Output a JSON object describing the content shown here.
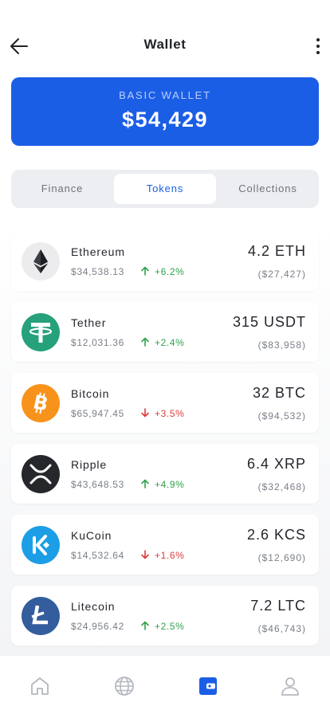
{
  "header": {
    "title": "Wallet"
  },
  "wallet_card": {
    "label": "BASIC WALLET",
    "amount": "$54,429"
  },
  "tabs": [
    {
      "label": "Finance"
    },
    {
      "label": "Tokens"
    },
    {
      "label": "Collections"
    }
  ],
  "tokens": [
    {
      "name": "Ethereum",
      "price": "$34,538.13",
      "change": "+6.2%",
      "direction": "up",
      "amount": "4.2 ETH",
      "value": "($27,427)",
      "icon": "ethereum-icon"
    },
    {
      "name": "Tether",
      "price": "$12,031.36",
      "change": "+2.4%",
      "direction": "up",
      "amount": "315 USDT",
      "value": "($83,958)",
      "icon": "tether-icon"
    },
    {
      "name": "Bitcoin",
      "price": "$65,947.45",
      "change": "+3.5%",
      "direction": "down",
      "amount": "32 BTC",
      "value": "($94,532)",
      "icon": "bitcoin-icon"
    },
    {
      "name": "Ripple",
      "price": "$43,648.53",
      "change": "+4.9%",
      "direction": "up",
      "amount": "6.4 XRP",
      "value": "($32,468)",
      "icon": "ripple-icon"
    },
    {
      "name": "KuCoin",
      "price": "$14,532.64",
      "change": "+1.6%",
      "direction": "down",
      "amount": "2.6 KCS",
      "value": "($12,690)",
      "icon": "kucoin-icon"
    },
    {
      "name": "Litecoin",
      "price": "$24,956.42",
      "change": "+2.5%",
      "direction": "up",
      "amount": "7.2 LTC",
      "value": "($46,743)",
      "icon": "litecoin-icon"
    }
  ],
  "bottom_nav": [
    {
      "icon": "home-icon",
      "active": false
    },
    {
      "icon": "globe-icon",
      "active": false
    },
    {
      "icon": "wallet-icon",
      "active": true
    },
    {
      "icon": "profile-icon",
      "active": false
    }
  ],
  "colors": {
    "accent": "#1b5ee6",
    "positive": "#2fa24a",
    "negative": "#e23a3a"
  }
}
